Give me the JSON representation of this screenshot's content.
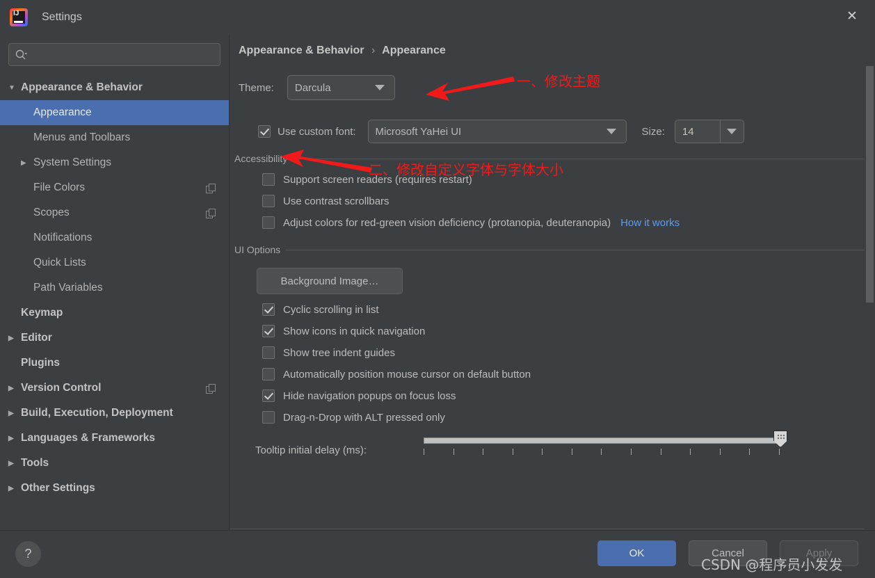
{
  "window": {
    "title": "Settings",
    "app_icon": "intellij-idea-logo",
    "close_icon": "close-icon"
  },
  "sidebar": {
    "search": {
      "placeholder": "",
      "value": "",
      "icon": "search-icon"
    },
    "items": [
      {
        "label": "Appearance & Behavior",
        "arrow": "down",
        "bold": true,
        "indent": 0,
        "selected": false,
        "copy_icon": false
      },
      {
        "label": "Appearance",
        "arrow": "none",
        "bold": false,
        "indent": 1,
        "selected": true,
        "copy_icon": false
      },
      {
        "label": "Menus and Toolbars",
        "arrow": "none",
        "bold": false,
        "indent": 1,
        "selected": false,
        "copy_icon": false
      },
      {
        "label": "System Settings",
        "arrow": "right",
        "bold": false,
        "indent": 1,
        "selected": false,
        "copy_icon": false
      },
      {
        "label": "File Colors",
        "arrow": "none",
        "bold": false,
        "indent": 1,
        "selected": false,
        "copy_icon": true
      },
      {
        "label": "Scopes",
        "arrow": "none",
        "bold": false,
        "indent": 1,
        "selected": false,
        "copy_icon": true
      },
      {
        "label": "Notifications",
        "arrow": "none",
        "bold": false,
        "indent": 1,
        "selected": false,
        "copy_icon": false
      },
      {
        "label": "Quick Lists",
        "arrow": "none",
        "bold": false,
        "indent": 1,
        "selected": false,
        "copy_icon": false
      },
      {
        "label": "Path Variables",
        "arrow": "none",
        "bold": false,
        "indent": 1,
        "selected": false,
        "copy_icon": false
      },
      {
        "label": "Keymap",
        "arrow": "none",
        "bold": true,
        "indent": 0,
        "selected": false,
        "copy_icon": false
      },
      {
        "label": "Editor",
        "arrow": "right",
        "bold": true,
        "indent": 0,
        "selected": false,
        "copy_icon": false
      },
      {
        "label": "Plugins",
        "arrow": "none",
        "bold": true,
        "indent": 0,
        "selected": false,
        "copy_icon": false
      },
      {
        "label": "Version Control",
        "arrow": "right",
        "bold": true,
        "indent": 0,
        "selected": false,
        "copy_icon": true
      },
      {
        "label": "Build, Execution, Deployment",
        "arrow": "right",
        "bold": true,
        "indent": 0,
        "selected": false,
        "copy_icon": false
      },
      {
        "label": "Languages & Frameworks",
        "arrow": "right",
        "bold": true,
        "indent": 0,
        "selected": false,
        "copy_icon": false
      },
      {
        "label": "Tools",
        "arrow": "right",
        "bold": true,
        "indent": 0,
        "selected": false,
        "copy_icon": false
      },
      {
        "label": "Other Settings",
        "arrow": "right",
        "bold": true,
        "indent": 0,
        "selected": false,
        "copy_icon": false
      }
    ]
  },
  "main": {
    "breadcrumb": {
      "root": "Appearance & Behavior",
      "separator": "›",
      "leaf": "Appearance"
    },
    "theme": {
      "label": "Theme:",
      "value": "Darcula"
    },
    "custom_font": {
      "checkbox_label": "Use custom font:",
      "checked": true,
      "font_value": "Microsoft YaHei UI",
      "size_label": "Size:",
      "size_value": "14"
    },
    "accessibility": {
      "title": "Accessibility",
      "options": [
        {
          "label": "Support screen readers (requires restart)",
          "checked": false,
          "link": ""
        },
        {
          "label": "Use contrast scrollbars",
          "checked": false,
          "link": ""
        },
        {
          "label": "Adjust colors for red-green vision deficiency (protanopia, deuteranopia)",
          "checked": false,
          "link": "How it works"
        }
      ]
    },
    "ui_options": {
      "title": "UI Options",
      "background_image_button": "Background Image…",
      "options": [
        {
          "label": "Cyclic scrolling in list",
          "checked": true
        },
        {
          "label": "Show icons in quick navigation",
          "checked": true
        },
        {
          "label": "Show tree indent guides",
          "checked": false
        },
        {
          "label": "Automatically position mouse cursor on default button",
          "checked": false
        },
        {
          "label": "Hide navigation popups on focus loss",
          "checked": true
        },
        {
          "label": "Drag-n-Drop with ALT pressed only",
          "checked": false
        }
      ],
      "tooltip_delay": {
        "label": "Tooltip initial delay (ms):",
        "thumb_position_percent": 100,
        "tick_count": 13
      }
    }
  },
  "footer": {
    "help_icon": "question-mark-icon",
    "ok": "OK",
    "cancel": "Cancel",
    "apply": "Apply"
  },
  "annotations": [
    {
      "text": "一、修改主题",
      "color": "#f01a1a"
    },
    {
      "text": "二、修改自定义字体与字体大小",
      "color": "#f01a1a"
    }
  ],
  "watermark": "CSDN @程序员小发发",
  "colors": {
    "background": "#3c3f41",
    "selection": "#4b6eaf",
    "accent_link": "#589df6",
    "annotation_red": "#f01a1a"
  }
}
